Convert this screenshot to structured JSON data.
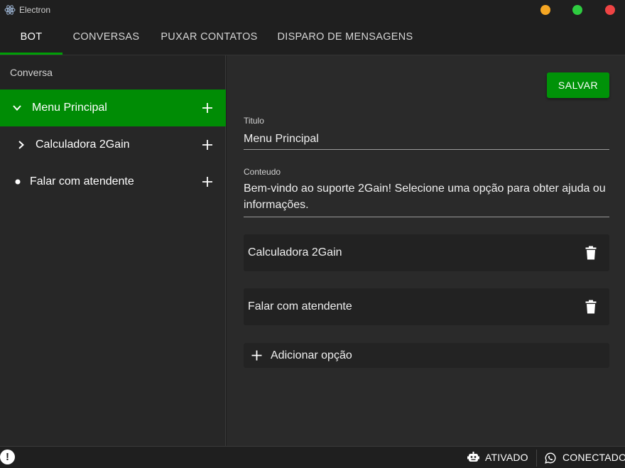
{
  "window": {
    "title": "Electron",
    "controls": {
      "minimize_color": "#f5a623",
      "maximize_color": "#2ecc40",
      "close_color": "#ef4444"
    }
  },
  "tabs": [
    {
      "label": "BOT",
      "active": true
    },
    {
      "label": "CONVERSAS",
      "active": false
    },
    {
      "label": "PUXAR CONTATOS",
      "active": false
    },
    {
      "label": "DISPARO DE MENSAGENS",
      "active": false
    }
  ],
  "sidebar": {
    "header": "Conversa",
    "items": [
      {
        "label": "Menu Principal",
        "icon": "chevron-down-icon",
        "selected": true
      },
      {
        "label": "Calculadora 2Gain",
        "icon": "chevron-right-icon",
        "selected": false
      },
      {
        "label": "Falar com atendente",
        "icon": "bullet-icon",
        "selected": false
      }
    ]
  },
  "editor": {
    "save_label": "SALVAR",
    "title_label": "Titulo",
    "title_value": "Menu Principal",
    "content_label": "Conteudo",
    "content_value": "Bem-vindo ao suporte 2Gain! Selecione uma opção para obter ajuda ou informações.",
    "options": [
      {
        "label": "Calculadora 2Gain"
      },
      {
        "label": "Falar com atendente"
      }
    ],
    "add_option_label": "Adicionar opção"
  },
  "statusbar": {
    "bot_status": "ATIVADO",
    "whatsapp_status": "CONECTADO",
    "alert_icon": "alert-icon"
  },
  "colors": {
    "accent": "#008c05",
    "background": "#1f1f1f",
    "panel": "#2a2a2a"
  }
}
